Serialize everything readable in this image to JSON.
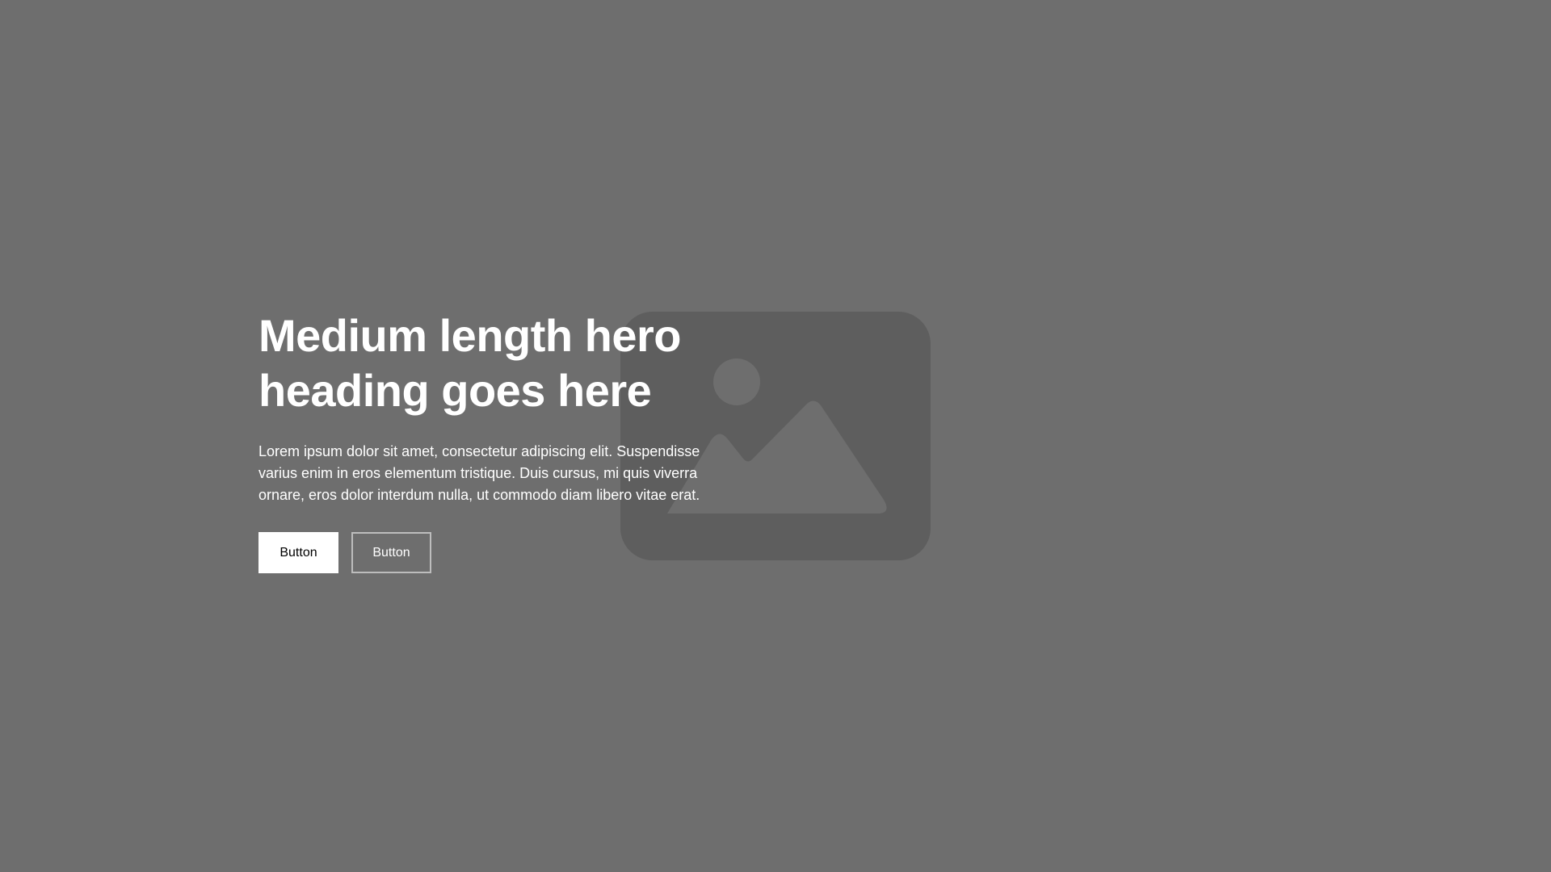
{
  "hero": {
    "heading": "Medium length hero heading goes here",
    "paragraph": "Lorem ipsum dolor sit amet, consectetur adipiscing elit. Suspendisse varius enim in eros elementum tristique. Duis cursus, mi quis viverra ornare, eros dolor interdum nulla, ut commodo diam libero vitae erat.",
    "primary_button_label": "Button",
    "secondary_button_label": "Button",
    "image_placeholder_icon": "image-placeholder-icon"
  },
  "colors": {
    "background": "#6e6e6e",
    "placeholder": "#5e5e5e",
    "placeholder_shapes": "#6e6e6e",
    "text": "#ffffff",
    "primary_button_bg": "#ffffff",
    "primary_button_text": "#000000",
    "secondary_button_border": "#bdbdbd"
  }
}
